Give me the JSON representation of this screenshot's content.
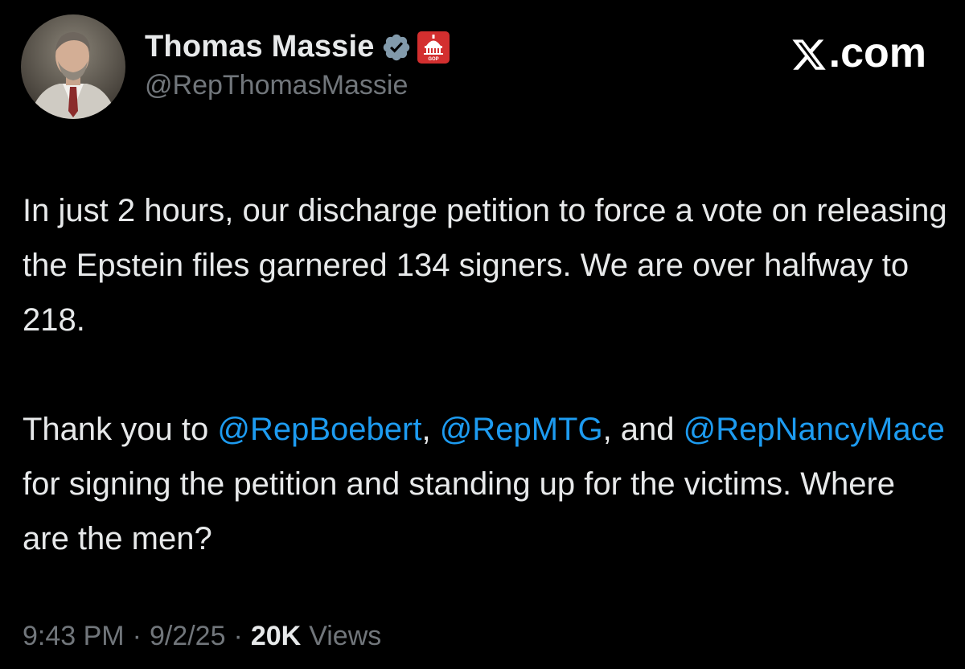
{
  "author": {
    "display_name": "Thomas Massie",
    "handle": "@RepThomasMassie",
    "verified_icon": "verified-badge-icon",
    "affiliate_icon": "house-gop-capitol-icon",
    "affiliate_badge_text": "GOP"
  },
  "brand": {
    "text": ".com",
    "logo_icon": "x-logo-icon"
  },
  "tweet": {
    "p1": "In just 2 hours, our discharge petition to force a vote on releasing the Epstein files garnered 134 signers. We are over halfway to 218.",
    "p2_prefix": "Thank you to ",
    "mention_1": "@RepBoebert",
    "sep_1": ", ",
    "mention_2": "@RepMTG",
    "sep_2": ", and ",
    "mention_3": "@RepNancyMace",
    "p2_suffix": " for signing the petition and standing up for the victims. Where are the men?"
  },
  "meta": {
    "time": "9:43 PM",
    "date": "9/2/25",
    "separator": "·",
    "views_count": "20K",
    "views_label": "Views"
  },
  "colors": {
    "background": "#000000",
    "text": "#e7e9ea",
    "secondary": "#71767b",
    "mention": "#1d9bf0",
    "verified_badge": "#829aab",
    "affiliate_badge": "#d32f2f"
  }
}
